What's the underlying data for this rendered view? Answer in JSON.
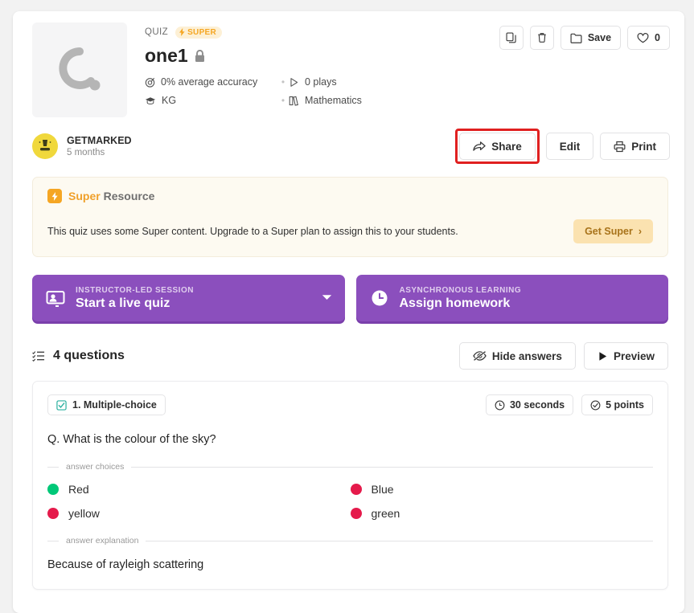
{
  "header": {
    "kicker": "QUIZ",
    "super_badge": "SUPER",
    "title": "one1",
    "lock_icon": "lock-icon",
    "meta": [
      {
        "icon": "target-icon",
        "text": "0% average accuracy"
      },
      {
        "icon": "play-icon",
        "text": "0 plays"
      },
      {
        "icon": "graduation-cap-icon",
        "text": "KG"
      },
      {
        "icon": "book-icon",
        "text": "Mathematics"
      }
    ],
    "actions": {
      "copy_label": "",
      "delete_label": "",
      "save_label": "Save",
      "like_count": "0"
    }
  },
  "author": {
    "name": "GETMARKED",
    "time": "5 months",
    "share_label": "Share",
    "edit_label": "Edit",
    "print_label": "Print"
  },
  "super_banner": {
    "title_highlight": "Super",
    "title_rest": "Resource",
    "body": "This quiz uses some Super content. Upgrade to a Super plan to assign this to your students.",
    "cta_label": "Get Super",
    "cta_chevron": "›"
  },
  "modes": [
    {
      "kicker": "INSTRUCTOR-LED SESSION",
      "label": "Start a live quiz",
      "icon": "presentation-icon",
      "has_caret": true
    },
    {
      "kicker": "ASYNCHRONOUS LEARNING",
      "label": "Assign homework",
      "icon": "clock-icon",
      "has_caret": false
    }
  ],
  "questions_bar": {
    "count_label": "4 questions",
    "hide_answers_label": "Hide answers",
    "preview_label": "Preview"
  },
  "question": {
    "type_label": "1. Multiple-choice",
    "time_label": "30 seconds",
    "points_label": "5 points",
    "prompt": "Q. What is the colour of the sky?",
    "choices_divider": "answer choices",
    "choices": [
      {
        "label": "Red",
        "color": "#00c878",
        "correct": true
      },
      {
        "label": "Blue",
        "color": "#e51a4b",
        "correct": false
      },
      {
        "label": "yellow",
        "color": "#e51a4b",
        "correct": false
      },
      {
        "label": "green",
        "color": "#e51a4b",
        "correct": false
      }
    ],
    "explanation_divider": "answer explanation",
    "explanation": "Because of rayleigh scattering"
  },
  "colors": {
    "page_bg": "#f2f2f2",
    "purple": "#8b4fbd",
    "purple_shadow": "#7a3fab",
    "super_orange": "#f5a623",
    "banner_bg": "#fdfaf1",
    "highlight_red": "#e02020",
    "correct_green": "#00c878",
    "wrong_red": "#e51a4b"
  }
}
